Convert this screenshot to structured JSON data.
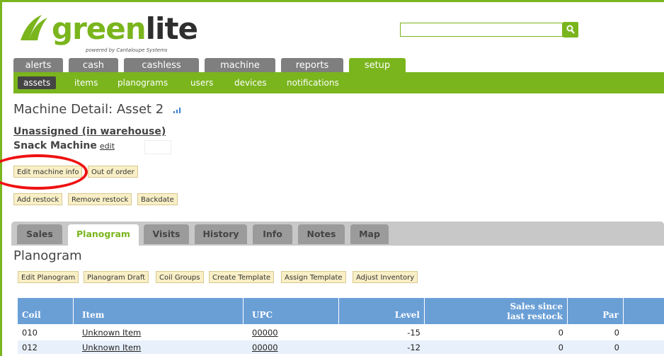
{
  "logo": {
    "green": "green",
    "dark": "lite",
    "tm": "™",
    "powered_by": "powered by Cantaloupe Systems"
  },
  "search": {
    "value": ""
  },
  "main_tabs": [
    {
      "label": "alerts"
    },
    {
      "label": "cash"
    },
    {
      "label": "cashless"
    },
    {
      "label": "machine"
    },
    {
      "label": "reports"
    },
    {
      "label": "setup"
    }
  ],
  "subnav": [
    {
      "label": "assets"
    },
    {
      "label": "items"
    },
    {
      "label": "planograms"
    },
    {
      "label": "users"
    },
    {
      "label": "devices"
    },
    {
      "label": "notifications"
    }
  ],
  "page_title": "Machine Detail: Asset 2",
  "location": "Unassigned (in warehouse)",
  "machine_type": "Snack Machine",
  "machine_type_edit": "edit",
  "buttons_row1": {
    "edit_info": "Edit machine info",
    "out_of_order": "Out of order"
  },
  "buttons_row2": {
    "add_restock": "Add restock",
    "remove_restock": "Remove restock",
    "backdate": "Backdate"
  },
  "detail_tabs": [
    {
      "label": "Sales"
    },
    {
      "label": "Planogram"
    },
    {
      "label": "Visits"
    },
    {
      "label": "History"
    },
    {
      "label": "Info"
    },
    {
      "label": "Notes"
    },
    {
      "label": "Map"
    }
  ],
  "section_title": "Planogram",
  "planogram_buttons": {
    "edit": "Edit Planogram",
    "draft": "Planogram Draft",
    "coil_groups": "Coil Groups",
    "create_template": "Create Template",
    "assign_template": "Assign Template",
    "adjust_inventory": "Adjust Inventory"
  },
  "table": {
    "headers": {
      "coil": "Coil",
      "item": "Item",
      "upc": "UPC",
      "level": "Level",
      "sales_line1": "Sales since",
      "sales_line2": "last restock",
      "par": "Par"
    },
    "rows": [
      {
        "coil": "010",
        "item": "Unknown Item",
        "upc": "00000",
        "level": "-15",
        "sales": "0",
        "par": "0"
      },
      {
        "coil": "012",
        "item": "Unknown Item",
        "upc": "00000",
        "level": "-12",
        "sales": "0",
        "par": "0"
      }
    ]
  },
  "colors": {
    "brand_green": "#7ab51d",
    "tab_gray": "#7f7f7f",
    "header_blue": "#6a9fd6",
    "annotation_red": "#e11111"
  }
}
